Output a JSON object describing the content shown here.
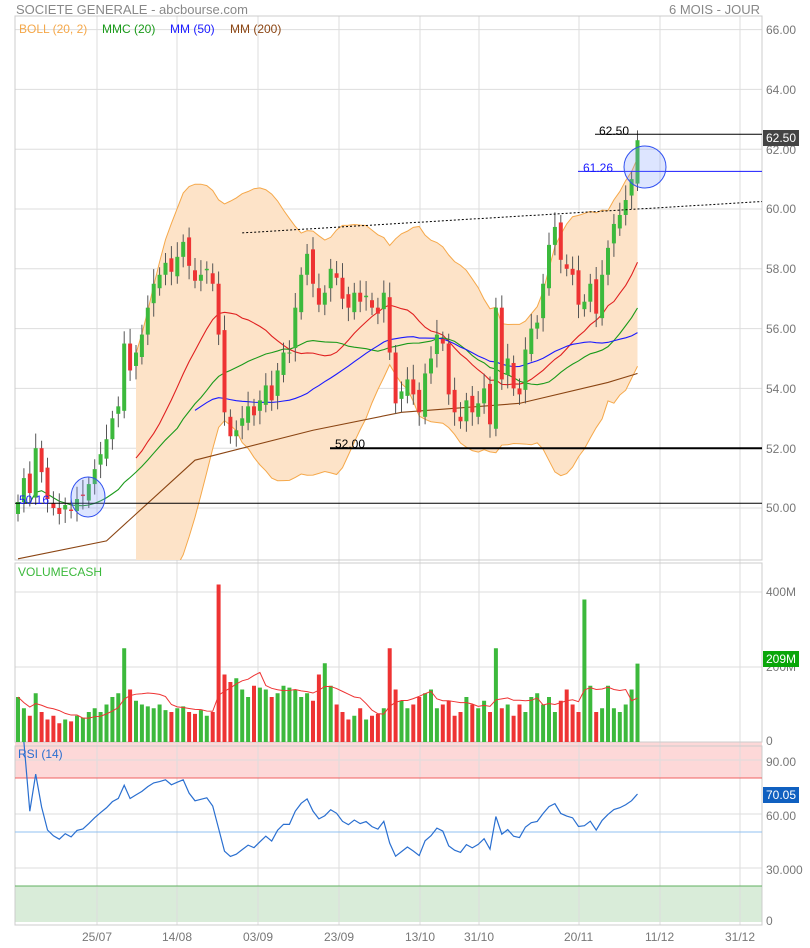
{
  "header": {
    "title": "SOCIETE GENERALE - abcbourse.com",
    "period": "6 MOIS - JOUR"
  },
  "legend": [
    {
      "label": "BOLL (20, 2)",
      "color": "#f5a84a"
    },
    {
      "label": "MMC (20)",
      "color": "#1a9a1a"
    },
    {
      "label": "MM (50)",
      "color": "#1a1aff"
    },
    {
      "label": "MM (200)",
      "color": "#8b4513"
    }
  ],
  "price_axis": [
    "66.00",
    "64.00",
    "62.00",
    "60.00",
    "58.00",
    "56.00",
    "54.00",
    "52.00",
    "50.00"
  ],
  "volume_panel": {
    "title": "VOLUMECASH",
    "axis": [
      "400M",
      "200M",
      "0"
    ],
    "last_tag": "209M"
  },
  "rsi_panel": {
    "title": "RSI (14)",
    "axis": [
      "90.00",
      "60.00",
      "30.000",
      "0"
    ],
    "last_tag": "70.05"
  },
  "x_labels": [
    "25/07",
    "14/08",
    "03/09",
    "23/09",
    "13/10",
    "31/10",
    "20/11",
    "11/12",
    "31/12"
  ],
  "annotations": {
    "last_price_tag": "62.50",
    "label_6250": "62.50",
    "label_6126": "61.26",
    "label_5200": "52.00",
    "label_5016": "50.16"
  },
  "colors": {
    "up": "#3cb93c",
    "down": "#ee3333",
    "boll_fill": "#fde3c8",
    "boll_line": "#f5a84a",
    "mid": "#e02020",
    "mmc": "#1a9a1a",
    "mm50": "#1a1aff",
    "mm200": "#8b4513",
    "rsi": "#2a6fd0"
  },
  "chart_data": {
    "type": "candlestick",
    "title": "SOCIETE GENERALE",
    "ylim": [
      48.2,
      66
    ],
    "closes": [
      50.2,
      51.0,
      50.5,
      52.0,
      51.2,
      50.3,
      50.0,
      49.8,
      50.1,
      49.9,
      50.3,
      50.4,
      50.8,
      51.3,
      51.8,
      52.3,
      53.0,
      53.4,
      55.5,
      54.6,
      55.2,
      55.8,
      56.7,
      57.5,
      57.8,
      58.2,
      57.9,
      58.4,
      58.9,
      58.1,
      57.6,
      57.8,
      58.0,
      57.5,
      55.8,
      53.2,
      52.4,
      52.6,
      53.0,
      53.4,
      53.1,
      53.6,
      54.1,
      53.6,
      54.6,
      55.2,
      55.2,
      56.7,
      57.8,
      58.5,
      57.5,
      56.8,
      57.2,
      58.0,
      57.7,
      57.0,
      56.7,
      57.2,
      56.9,
      57.1,
      56.7,
      56.5,
      57.2,
      55.2,
      53.5,
      53.9,
      54.3,
      53.8,
      53.2,
      54.5,
      55.0,
      55.8,
      55.5,
      53.8,
      53.2,
      52.9,
      53.6,
      53.2,
      53.5,
      54.0,
      52.8,
      56.7,
      54.3,
      55.0,
      54.0,
      53.8,
      55.3,
      56.0,
      56.2,
      57.5,
      58.8,
      59.4,
      58.3,
      58.0,
      57.8,
      56.8,
      56.9,
      57.5,
      56.5,
      57.8,
      58.7,
      59.5,
      59.8,
      60.3,
      61.0,
      62.3
    ],
    "volumes_M": [
      120,
      90,
      70,
      130,
      80,
      60,
      70,
      50,
      60,
      55,
      70,
      65,
      80,
      90,
      80,
      100,
      120,
      130,
      250,
      140,
      110,
      100,
      95,
      90,
      100,
      85,
      80,
      90,
      95,
      80,
      75,
      85,
      70,
      80,
      420,
      180,
      160,
      170,
      140,
      120,
      150,
      145,
      140,
      120,
      130,
      150,
      145,
      140,
      120,
      130,
      110,
      180,
      210,
      150,
      100,
      80,
      60,
      70,
      90,
      60,
      70,
      75,
      90,
      250,
      140,
      110,
      90,
      100,
      120,
      130,
      140,
      90,
      100,
      110,
      70,
      80,
      120,
      100,
      90,
      110,
      80,
      250,
      90,
      100,
      70,
      100,
      80,
      120,
      130,
      100,
      120,
      80,
      110,
      140,
      100,
      80,
      380,
      150,
      80,
      90,
      150,
      90,
      80,
      100,
      140,
      209
    ],
    "mm200_points": [
      [
        0,
        48.3
      ],
      [
        15,
        48.9
      ],
      [
        30,
        51.6
      ],
      [
        50,
        52.6
      ],
      [
        65,
        53.2
      ],
      [
        85,
        53.5
      ],
      [
        100,
        54.2
      ],
      [
        105,
        54.5
      ]
    ],
    "rsi_bands": {
      "overbought": 80,
      "oversold": 20,
      "mid": 50
    },
    "levels": [
      62.5,
      61.26,
      52.0,
      50.16
    ],
    "trendline": [
      [
        38,
        59.2
      ],
      [
        126,
        60.2
      ]
    ]
  }
}
